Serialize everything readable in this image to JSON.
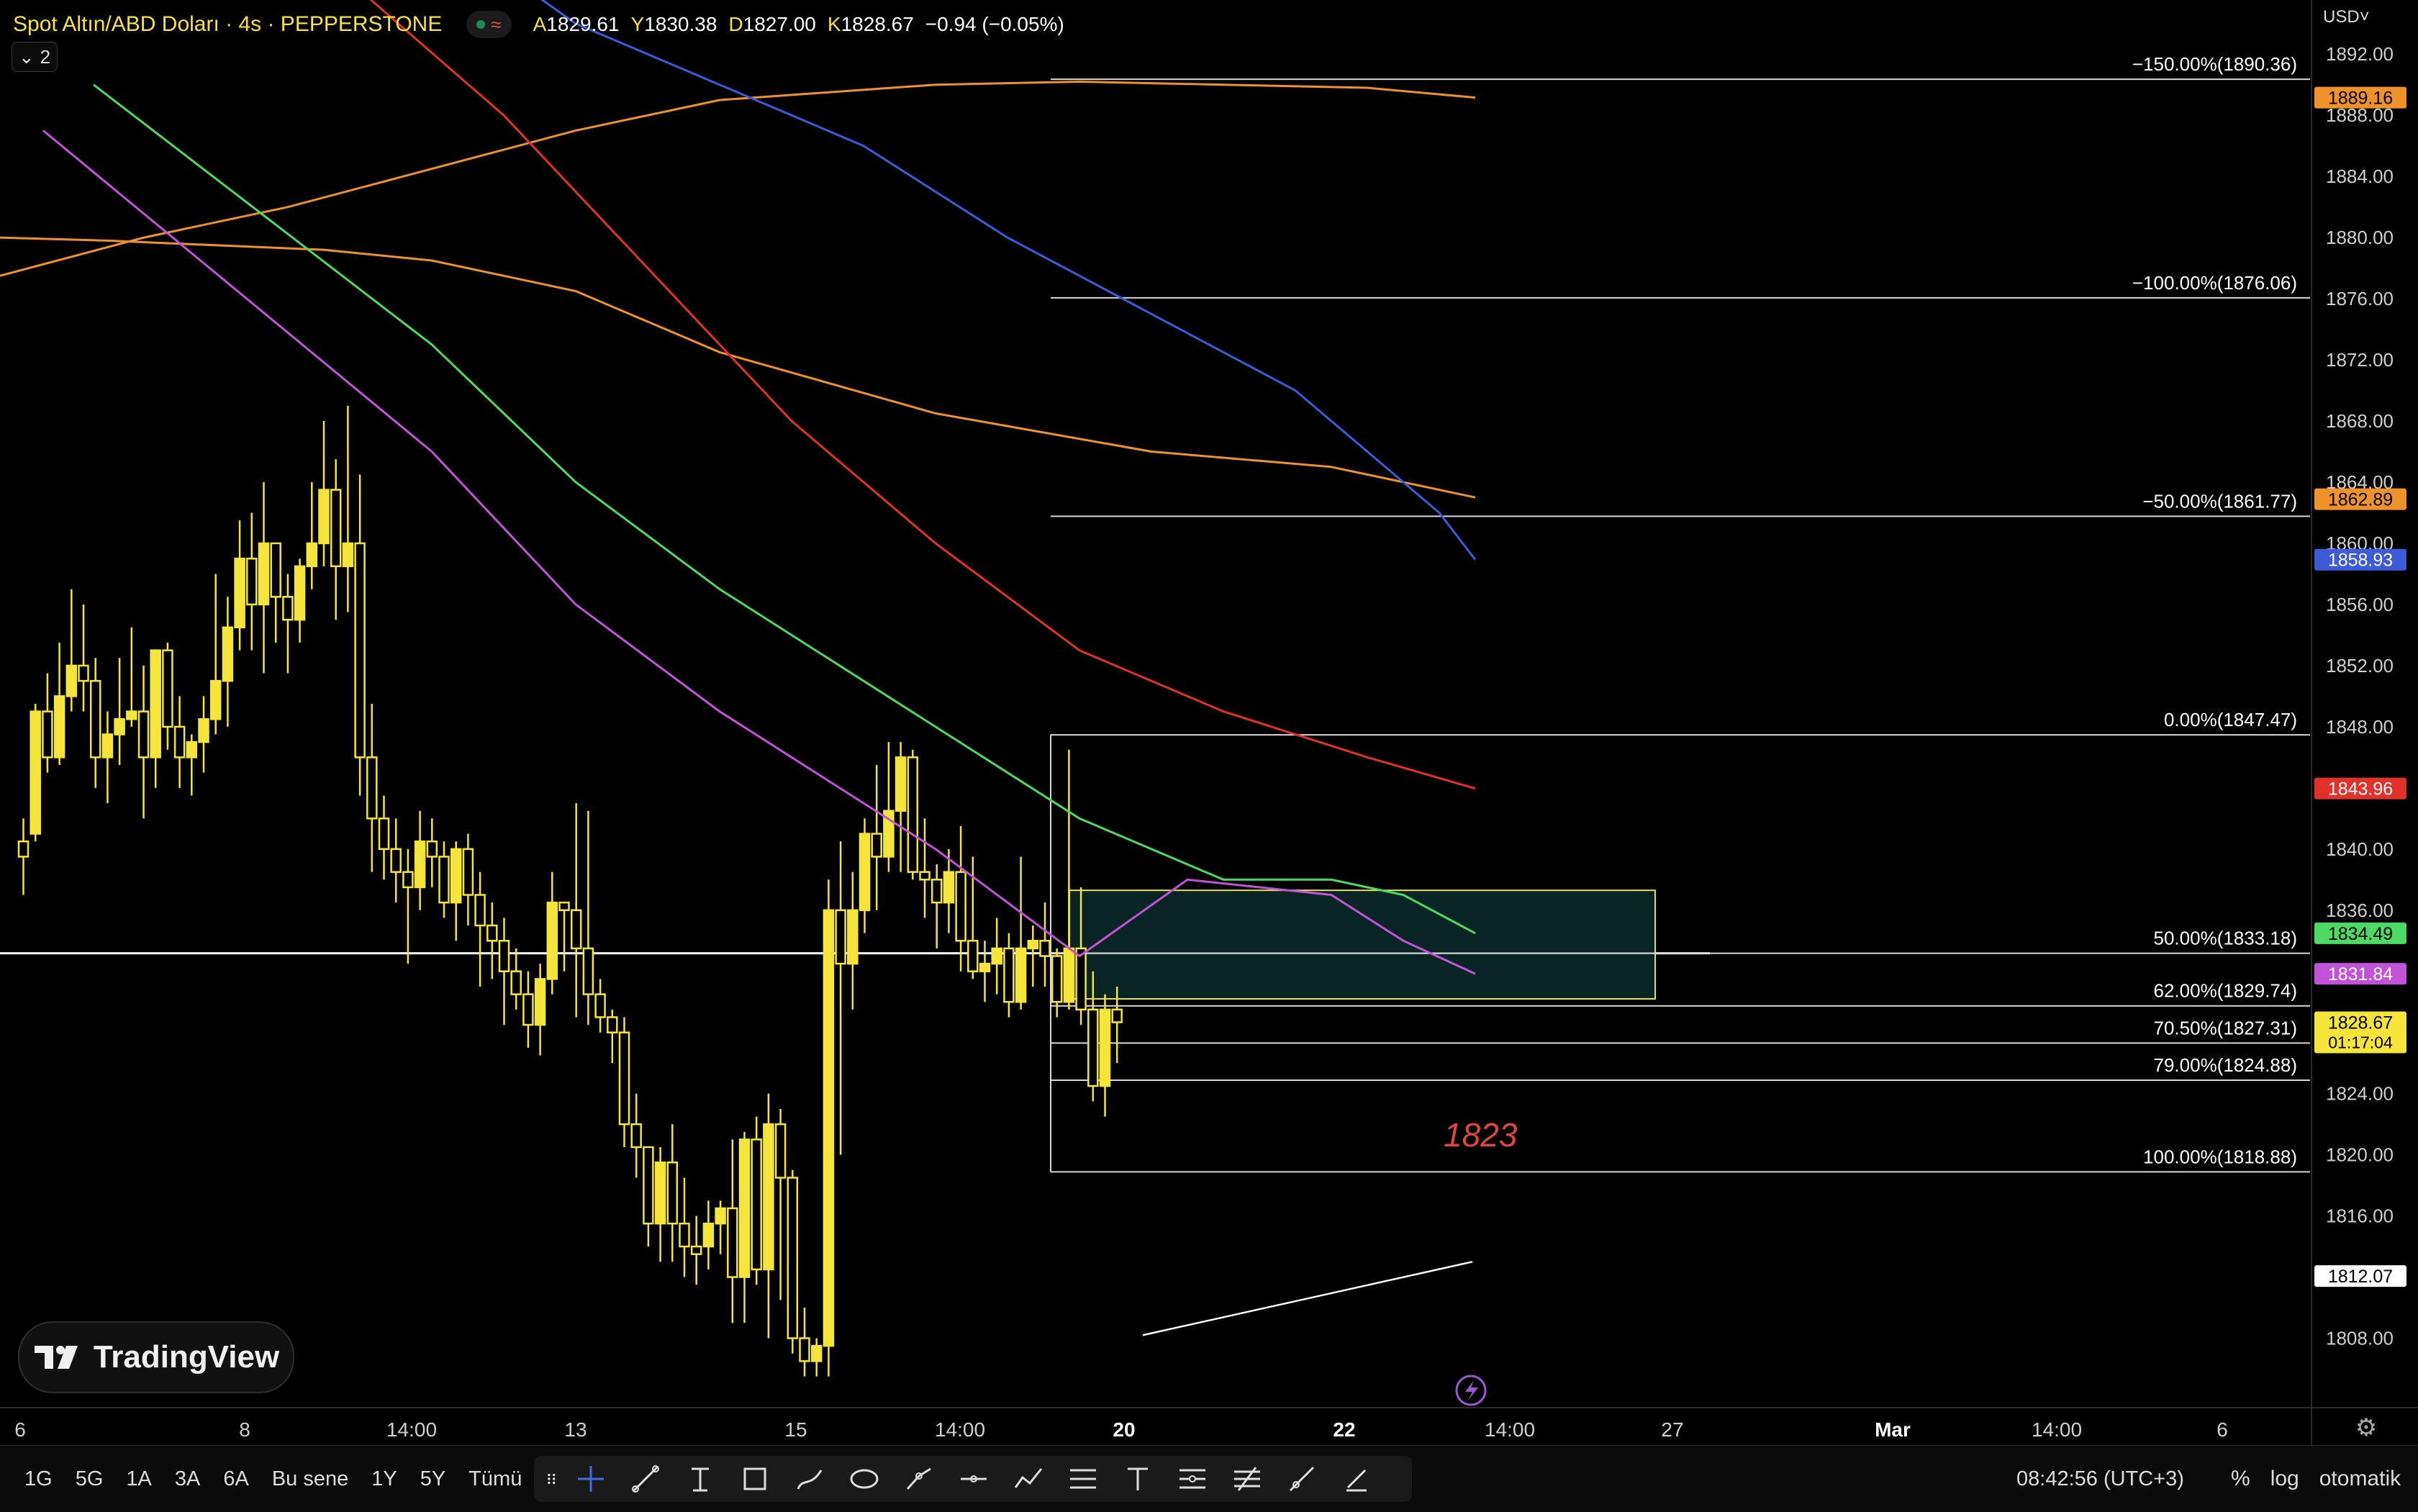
{
  "header": {
    "symbol": "Spot Altın/ABD Doları · 4s · PEPPERSTONE",
    "wave_glyph": "≈",
    "ohlc": [
      {
        "k": "A",
        "v": "1829.61"
      },
      {
        "k": "Y",
        "v": "1830.38"
      },
      {
        "k": "D",
        "v": "1827.00"
      },
      {
        "k": "K",
        "v": "1828.67"
      }
    ],
    "change": "−0.94 (−0.05%)"
  },
  "indicator_toggle": {
    "count": "2",
    "chevron": "⌄"
  },
  "currency": "USD˅",
  "colors": {
    "bg": "#000000",
    "candle": "#f5e43a",
    "ema_orange": "#f0922b",
    "ema_blue": "#3d5bd9",
    "ema_red": "#e0312b",
    "ema_green": "#4cd964",
    "ema_magenta": "#c153d8",
    "fib_line": "#d8d8d8",
    "zone_fill": "#0b2a2a",
    "zone_border": "#e8dd5a",
    "annotation": "#e04545"
  },
  "chart_data": {
    "type": "candlestick",
    "price_axis": {
      "ylim": [
        1806.0,
        1893.0
      ],
      "ticks": [
        "1892.00",
        "1888.00",
        "1884.00",
        "1880.00",
        "1876.00",
        "1872.00",
        "1868.00",
        "1864.00",
        "1860.00",
        "1856.00",
        "1852.00",
        "1848.00",
        "1844.00",
        "1840.00",
        "1836.00",
        "1832.00",
        "1828.00",
        "1824.00",
        "1820.00",
        "1816.00",
        "1812.00",
        "1808.00"
      ]
    },
    "time_axis": {
      "labels": [
        "6",
        "8",
        "14:00",
        "13",
        "15",
        "14:00",
        "20",
        "22",
        "14:00",
        "27",
        "Mar",
        "14:00",
        "6"
      ],
      "highlighted": [
        "20",
        "22",
        "Mar"
      ]
    },
    "candles": [
      [
        1840.5,
        1842.0,
        1837.0,
        1839.5
      ],
      [
        1841.0,
        1849.5,
        1840.5,
        1849.0
      ],
      [
        1849.0,
        1851.5,
        1845.0,
        1846.0
      ],
      [
        1846.0,
        1853.5,
        1845.5,
        1850.0
      ],
      [
        1850.0,
        1857.0,
        1849.0,
        1852.0
      ],
      [
        1852.0,
        1856.0,
        1849.0,
        1851.0
      ],
      [
        1851.0,
        1852.5,
        1844.0,
        1846.0
      ],
      [
        1846.0,
        1849.0,
        1843.0,
        1847.5
      ],
      [
        1847.5,
        1852.5,
        1845.5,
        1848.5
      ],
      [
        1848.5,
        1854.5,
        1848.0,
        1849.0
      ],
      [
        1849.0,
        1852.0,
        1842.0,
        1846.0
      ],
      [
        1846.0,
        1853.0,
        1844.0,
        1853.0
      ],
      [
        1853.0,
        1853.5,
        1846.5,
        1848.0
      ],
      [
        1848.0,
        1850.0,
        1844.0,
        1846.0
      ],
      [
        1846.0,
        1847.5,
        1843.5,
        1847.0
      ],
      [
        1847.0,
        1850.0,
        1845.0,
        1848.5
      ],
      [
        1848.5,
        1858.0,
        1847.5,
        1851.0
      ],
      [
        1851.0,
        1856.5,
        1848.0,
        1854.5
      ],
      [
        1854.5,
        1861.5,
        1853.0,
        1859.0
      ],
      [
        1859.0,
        1862.0,
        1853.0,
        1856.0
      ],
      [
        1856.0,
        1864.0,
        1851.5,
        1860.0
      ],
      [
        1860.0,
        1860.0,
        1853.5,
        1856.5
      ],
      [
        1856.5,
        1858.0,
        1851.5,
        1855.0
      ],
      [
        1855.0,
        1859.0,
        1853.5,
        1858.5
      ],
      [
        1858.5,
        1864.0,
        1857.0,
        1860.0
      ],
      [
        1860.0,
        1868.0,
        1858.5,
        1863.5
      ],
      [
        1863.5,
        1865.5,
        1855.0,
        1858.5
      ],
      [
        1858.5,
        1869.0,
        1855.5,
        1860.0
      ],
      [
        1860.0,
        1864.5,
        1843.5,
        1846.0
      ],
      [
        1846.0,
        1849.5,
        1838.5,
        1842.0
      ],
      [
        1842.0,
        1843.5,
        1838.0,
        1840.0
      ],
      [
        1840.0,
        1842.0,
        1836.5,
        1838.5
      ],
      [
        1838.5,
        1840.0,
        1832.5,
        1837.5
      ],
      [
        1837.5,
        1842.5,
        1836.0,
        1840.5
      ],
      [
        1840.5,
        1842.0,
        1837.5,
        1839.5
      ],
      [
        1839.5,
        1840.5,
        1835.5,
        1836.5
      ],
      [
        1836.5,
        1840.5,
        1834.0,
        1840.0
      ],
      [
        1840.0,
        1841.0,
        1835.0,
        1837.0
      ],
      [
        1837.0,
        1838.5,
        1831.0,
        1835.0
      ],
      [
        1835.0,
        1836.5,
        1831.5,
        1834.0
      ],
      [
        1834.0,
        1835.5,
        1828.5,
        1832.0
      ],
      [
        1832.0,
        1833.5,
        1829.5,
        1830.5
      ],
      [
        1830.5,
        1832.0,
        1827.0,
        1828.5
      ],
      [
        1828.5,
        1832.5,
        1826.5,
        1831.5
      ],
      [
        1831.5,
        1838.5,
        1830.5,
        1836.5
      ],
      [
        1836.5,
        1836.5,
        1832.0,
        1836.0
      ],
      [
        1836.0,
        1843.0,
        1829.0,
        1833.5
      ],
      [
        1833.5,
        1842.5,
        1828.5,
        1830.5
      ],
      [
        1830.5,
        1831.5,
        1828.0,
        1829.0
      ],
      [
        1829.0,
        1829.5,
        1826.0,
        1828.0
      ],
      [
        1828.0,
        1829.0,
        1820.5,
        1822.0
      ],
      [
        1822.0,
        1824.0,
        1818.5,
        1820.5
      ],
      [
        1820.5,
        1817.0,
        1814.0,
        1815.5
      ],
      [
        1815.5,
        1820.5,
        1813.0,
        1819.5
      ],
      [
        1819.5,
        1822.0,
        1813.0,
        1815.5
      ],
      [
        1815.5,
        1818.5,
        1812.0,
        1814.0
      ],
      [
        1814.0,
        1816.0,
        1811.5,
        1813.5
      ],
      [
        1814.0,
        1817.0,
        1812.5,
        1815.5
      ],
      [
        1815.5,
        1817.0,
        1813.5,
        1816.5
      ],
      [
        1816.5,
        1821.0,
        1809.0,
        1812.0
      ],
      [
        1812.0,
        1821.5,
        1809.0,
        1821.0
      ],
      [
        1821.0,
        1822.5,
        1811.5,
        1812.5
      ],
      [
        1812.5,
        1824.0,
        1808.0,
        1822.0
      ],
      [
        1822.0,
        1823.0,
        1810.5,
        1818.5
      ],
      [
        1818.5,
        1819.0,
        1807.0,
        1808.0
      ],
      [
        1808.0,
        1810.0,
        1805.5,
        1806.5
      ],
      [
        1806.5,
        1808.0,
        1805.5,
        1807.5
      ],
      [
        1807.5,
        1838.0,
        1805.5,
        1836.0
      ],
      [
        1836.0,
        1840.5,
        1820.0,
        1832.5
      ],
      [
        1832.5,
        1838.5,
        1829.5,
        1836.0
      ],
      [
        1836.0,
        1842.0,
        1834.5,
        1841.0
      ],
      [
        1841.0,
        1845.5,
        1836.0,
        1839.5
      ],
      [
        1839.5,
        1847.0,
        1838.5,
        1842.5
      ],
      [
        1842.5,
        1847.0,
        1838.5,
        1846.0
      ],
      [
        1846.0,
        1846.5,
        1838.0,
        1838.5
      ],
      [
        1838.5,
        1842.0,
        1835.5,
        1838.0
      ],
      [
        1838.0,
        1839.0,
        1833.5,
        1836.5
      ],
      [
        1836.5,
        1840.0,
        1834.5,
        1838.5
      ],
      [
        1838.5,
        1841.5,
        1832.0,
        1834.0
      ],
      [
        1834.0,
        1839.5,
        1831.5,
        1832.0
      ],
      [
        1832.0,
        1834.0,
        1830.0,
        1832.5
      ],
      [
        1832.5,
        1835.5,
        1830.5,
        1833.5
      ],
      [
        1833.5,
        1834.5,
        1829.0,
        1830.0
      ],
      [
        1830.0,
        1839.5,
        1829.5,
        1833.5
      ],
      [
        1833.5,
        1835.0,
        1831.0,
        1834.0
      ],
      [
        1834.0,
        1836.5,
        1831.0,
        1833.0
      ],
      [
        1833.0,
        1833.5,
        1829.0,
        1830.0
      ],
      [
        1830.0,
        1846.5,
        1829.5,
        1833.5
      ],
      [
        1833.5,
        1837.5,
        1828.5,
        1829.5
      ],
      [
        1829.5,
        1832.0,
        1823.5,
        1824.5
      ],
      [
        1824.5,
        1830.5,
        1822.5,
        1829.5
      ],
      [
        1829.5,
        1831.0,
        1826.0,
        1828.67
      ]
    ],
    "moving_averages": [
      {
        "color_key": "ema_orange",
        "values": [
          1880.0,
          1879.8,
          1879.5,
          1879.2,
          1878.5,
          1876.5,
          1872.5,
          1868.5,
          1866.0,
          1865.0,
          1863.0
        ]
      },
      {
        "color_key": "ema_orange",
        "values": [
          1877.5,
          1880.0,
          1882.0,
          1884.5,
          1887.0,
          1889.0,
          1890.0,
          1890.2,
          1890.0,
          1889.8,
          1889.16
        ]
      },
      {
        "color_key": "ema_blue",
        "values": [
          1898.0,
          1894.0,
          1890.0,
          1886.0,
          1880.0,
          1875.0,
          1870.0,
          1866.0,
          1862.0,
          1858.93
        ]
      },
      {
        "color_key": "ema_red",
        "values": [
          1897.0,
          1888.0,
          1878.0,
          1868.0,
          1860.0,
          1853.0,
          1849.0,
          1846.0,
          1843.96
        ]
      },
      {
        "color_key": "ema_green",
        "values": [
          1890.0,
          1873.0,
          1864.0,
          1857.0,
          1848.0,
          1842.0,
          1838.0,
          1838.0,
          1837.0,
          1834.49
        ]
      },
      {
        "color_key": "ema_magenta",
        "values": [
          1887.0,
          1866.0,
          1856.0,
          1849.0,
          1840.0,
          1833.0,
          1838.0,
          1837.0,
          1834.0,
          1831.84
        ]
      }
    ],
    "fib_levels": [
      {
        "label": "−150.00%(1890.36)",
        "price": 1890.36
      },
      {
        "label": "−100.00%(1876.06)",
        "price": 1876.06
      },
      {
        "label": "−50.00%(1861.77)",
        "price": 1861.77
      },
      {
        "label": "0.00%(1847.47)",
        "price": 1847.47
      },
      {
        "label": "50.00%(1833.18)",
        "price": 1833.18
      },
      {
        "label": "62.00%(1829.74)",
        "price": 1829.74
      },
      {
        "label": "70.50%(1827.31)",
        "price": 1827.31
      },
      {
        "label": "79.00%(1824.88)",
        "price": 1824.88
      },
      {
        "label": "100.00%(1818.88)",
        "price": 1818.88
      }
    ],
    "horizontal_line": 1833.18,
    "zone": {
      "top": 1837.3,
      "bottom": 1830.2
    },
    "trend_line": {
      "from": 1808.2,
      "to": 1813.0
    },
    "annotation": {
      "text": "1823",
      "price": 1821.2
    },
    "price_tags": [
      {
        "price": 1889.16,
        "label": "1889.16",
        "color_key": "ema_orange",
        "text_color": "#000"
      },
      {
        "price": 1862.89,
        "label": "1862.89",
        "color_key": "ema_orange",
        "text_color": "#000"
      },
      {
        "price": 1858.93,
        "label": "1858.93",
        "color_key": "ema_blue",
        "text_color": "#fff"
      },
      {
        "price": 1843.96,
        "label": "1843.96",
        "color_key": "ema_red",
        "text_color": "#fff"
      },
      {
        "price": 1834.49,
        "label": "1834.49",
        "color_key": "ema_green",
        "text_color": "#000"
      },
      {
        "price": 1831.84,
        "label": "1831.84",
        "color_key": "ema_magenta",
        "text_color": "#fff"
      },
      {
        "price": 1828.67,
        "label": "1828.67",
        "sub": "01:17:04",
        "color_key": "candle",
        "text_color": "#000"
      },
      {
        "price": 1812.07,
        "label": "1812.07",
        "color": "#ffffff",
        "text_color": "#000"
      }
    ]
  },
  "bottom_bar": {
    "ranges": [
      "1G",
      "5G",
      "1A",
      "3A",
      "6A",
      "Bu sene",
      "1Y",
      "5Y",
      "Tümü"
    ],
    "tools": [
      "grip-icon",
      "crosshair-icon",
      "trendline-icon",
      "fib-icon",
      "rectangle-icon",
      "brush-icon",
      "ellipse-icon",
      "path-icon",
      "horizontal-line-icon",
      "polyline-icon",
      "parallel-channel-icon",
      "text-icon",
      "fib-retracement-icon",
      "pitchfork-icon",
      "ray-icon",
      "eraser-icon"
    ],
    "clock": "08:42:56 (UTC+3)",
    "percent": "%",
    "log": "log",
    "auto": "otomatik"
  },
  "watermark": "TradingView"
}
